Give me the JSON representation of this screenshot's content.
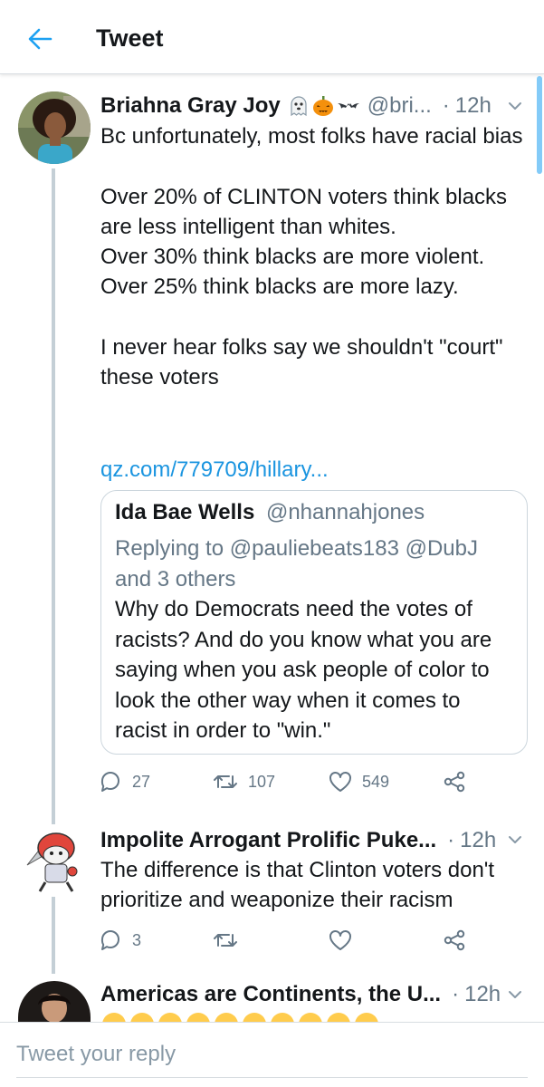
{
  "header": {
    "title": "Tweet"
  },
  "colors": {
    "accent": "#1da1f2",
    "link": "#1b95e0",
    "secondary_text": "#657786"
  },
  "tweet1": {
    "name": "Briahna Gray Joy",
    "name_emojis": [
      "ghost-emoji",
      "jack-o-lantern-emoji",
      "bat-emoji"
    ],
    "handle": "@bri...",
    "dot": "·",
    "time": "12h",
    "text": "Bc unfortunately, most folks have racial bias\n\nOver 20% of CLINTON voters think blacks are less intelligent than whites.\nOver 30% think blacks are more violent.\nOver 25% think blacks are more lazy.\n\nI never hear folks say we shouldn't \"court\" these voters",
    "link": "qz.com/779709/hillary...",
    "quote": {
      "name": "Ida Bae Wells",
      "handle": "@nhannahjones",
      "replying_prefix": "Replying to",
      "replying_mention1": "@pauliebeats183",
      "replying_mention2": "@DubJ",
      "replying_suffix": "and 3 others",
      "text": "Why do Democrats need the votes of racists? And do you know what you are saying when you ask people of color to look the other way when it comes to racist in order to \"win.\""
    },
    "actions": {
      "replies": "27",
      "retweets": "107",
      "likes": "549"
    }
  },
  "tweet2": {
    "name": "Impolite Arrogant Prolific Puke...",
    "dot": "·",
    "time": "12h",
    "text": "The difference is that Clinton voters don't prioritize and weaponize their racism",
    "actions": {
      "replies": "3"
    }
  },
  "tweet3": {
    "name": "Americas are Continents, the U...",
    "dot": "·",
    "time": "12h",
    "emoji_row": [
      "laughing-crying-emoji",
      "laughing-crying-emoji",
      "laughing-crying-emoji",
      "laughing-crying-emoji",
      "laughing-crying-emoji",
      "laughing-crying-emoji",
      "laughing-crying-emoji",
      "laughing-crying-emoji",
      "laughing-crying-emoji",
      "laughing-crying-emoji"
    ]
  },
  "reply": {
    "placeholder": "Tweet your reply"
  }
}
